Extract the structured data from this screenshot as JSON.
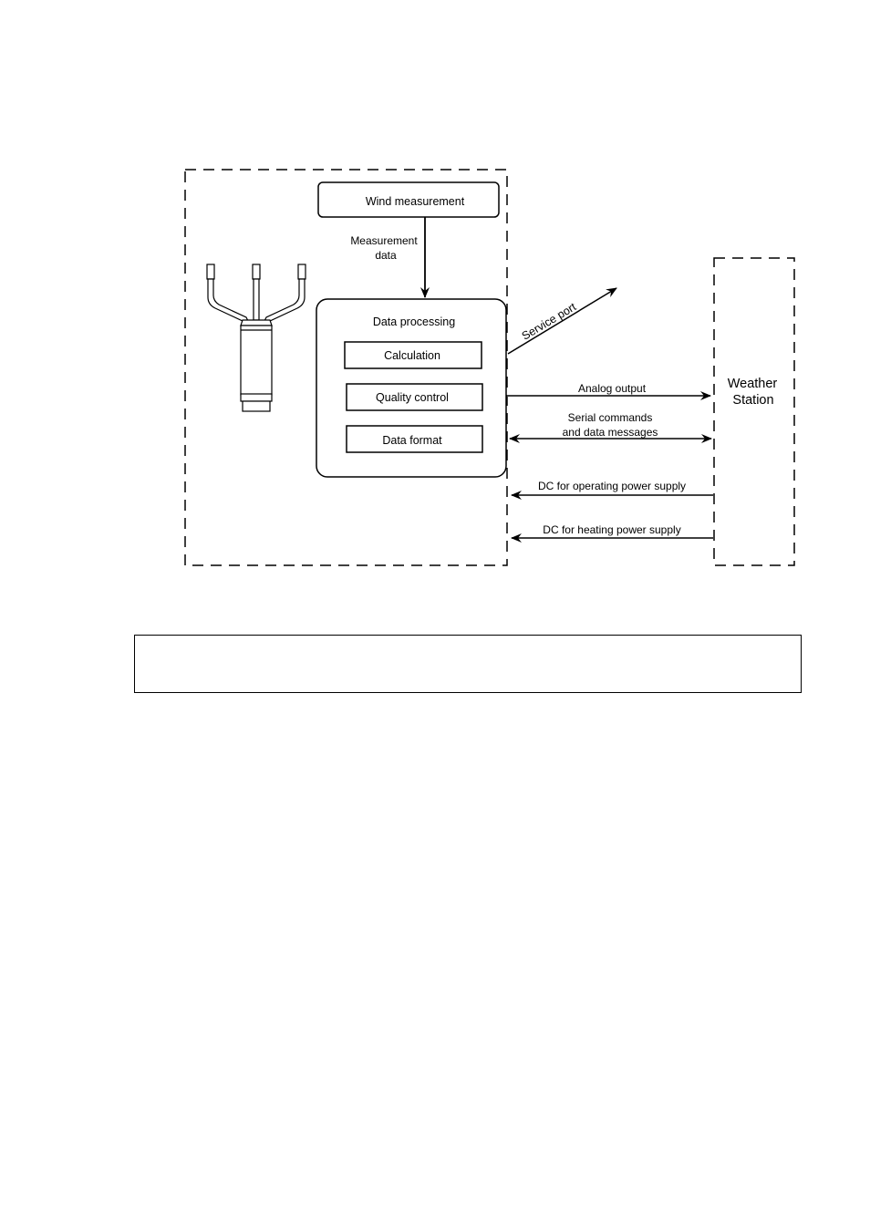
{
  "diagram": {
    "wind_measurement": "Wind measurement",
    "measurement_data": [
      "Measurement",
      "data"
    ],
    "data_processing": {
      "title": "Data processing",
      "steps": [
        "Calculation",
        "Quality control",
        "Data format"
      ]
    },
    "service_port": "Service port",
    "weather_station": [
      "Weather",
      "Station"
    ],
    "links": {
      "analog_output": "Analog output",
      "serial": [
        "Serial commands",
        "and data messages"
      ],
      "dc_operating": "DC for operating power supply",
      "dc_heating": "DC for heating power supply"
    },
    "icons": [
      "anemometer-sensor-illustration",
      "arrow-icon"
    ]
  },
  "note": ""
}
